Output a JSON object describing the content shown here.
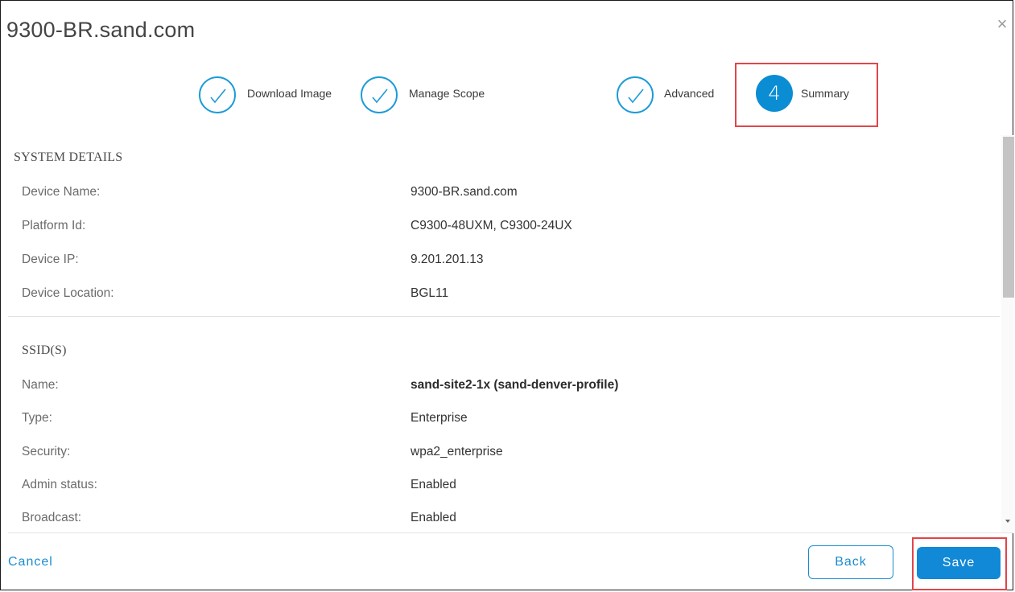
{
  "dialog": {
    "title": "9300-BR.sand.com",
    "close_glyph": "×"
  },
  "wizard": {
    "steps": [
      {
        "label": "Download Image",
        "state": "complete",
        "icon": "check-icon"
      },
      {
        "label": "Manage Scope",
        "state": "complete",
        "icon": "check-icon"
      },
      {
        "label": "Advanced",
        "state": "complete",
        "icon": "check-icon"
      },
      {
        "label": "Summary",
        "state": "active",
        "number": "4"
      }
    ]
  },
  "system_details": {
    "heading": "SYSTEM DETAILS",
    "rows": [
      {
        "label": "Device Name:",
        "value": "9300-BR.sand.com"
      },
      {
        "label": "Platform Id:",
        "value": "C9300-48UXM, C9300-24UX"
      },
      {
        "label": "Device IP:",
        "value": "9.201.201.13"
      },
      {
        "label": "Device Location:",
        "value": "BGL11"
      }
    ]
  },
  "ssids": {
    "heading": "SSID(S)",
    "rows": [
      {
        "label": "Name:",
        "value": "sand-site2-1x (sand-denver-profile)"
      },
      {
        "label": "Type:",
        "value": "Enterprise"
      },
      {
        "label": "Security:",
        "value": "wpa2_enterprise"
      },
      {
        "label": "Admin status:",
        "value": "Enabled"
      },
      {
        "label": "Broadcast:",
        "value": "Enabled"
      }
    ]
  },
  "footer": {
    "cancel_label": "Cancel",
    "back_label": "Back",
    "save_label": "Save"
  },
  "colors": {
    "accent": "#1189d6",
    "highlight": "#e0454a"
  }
}
